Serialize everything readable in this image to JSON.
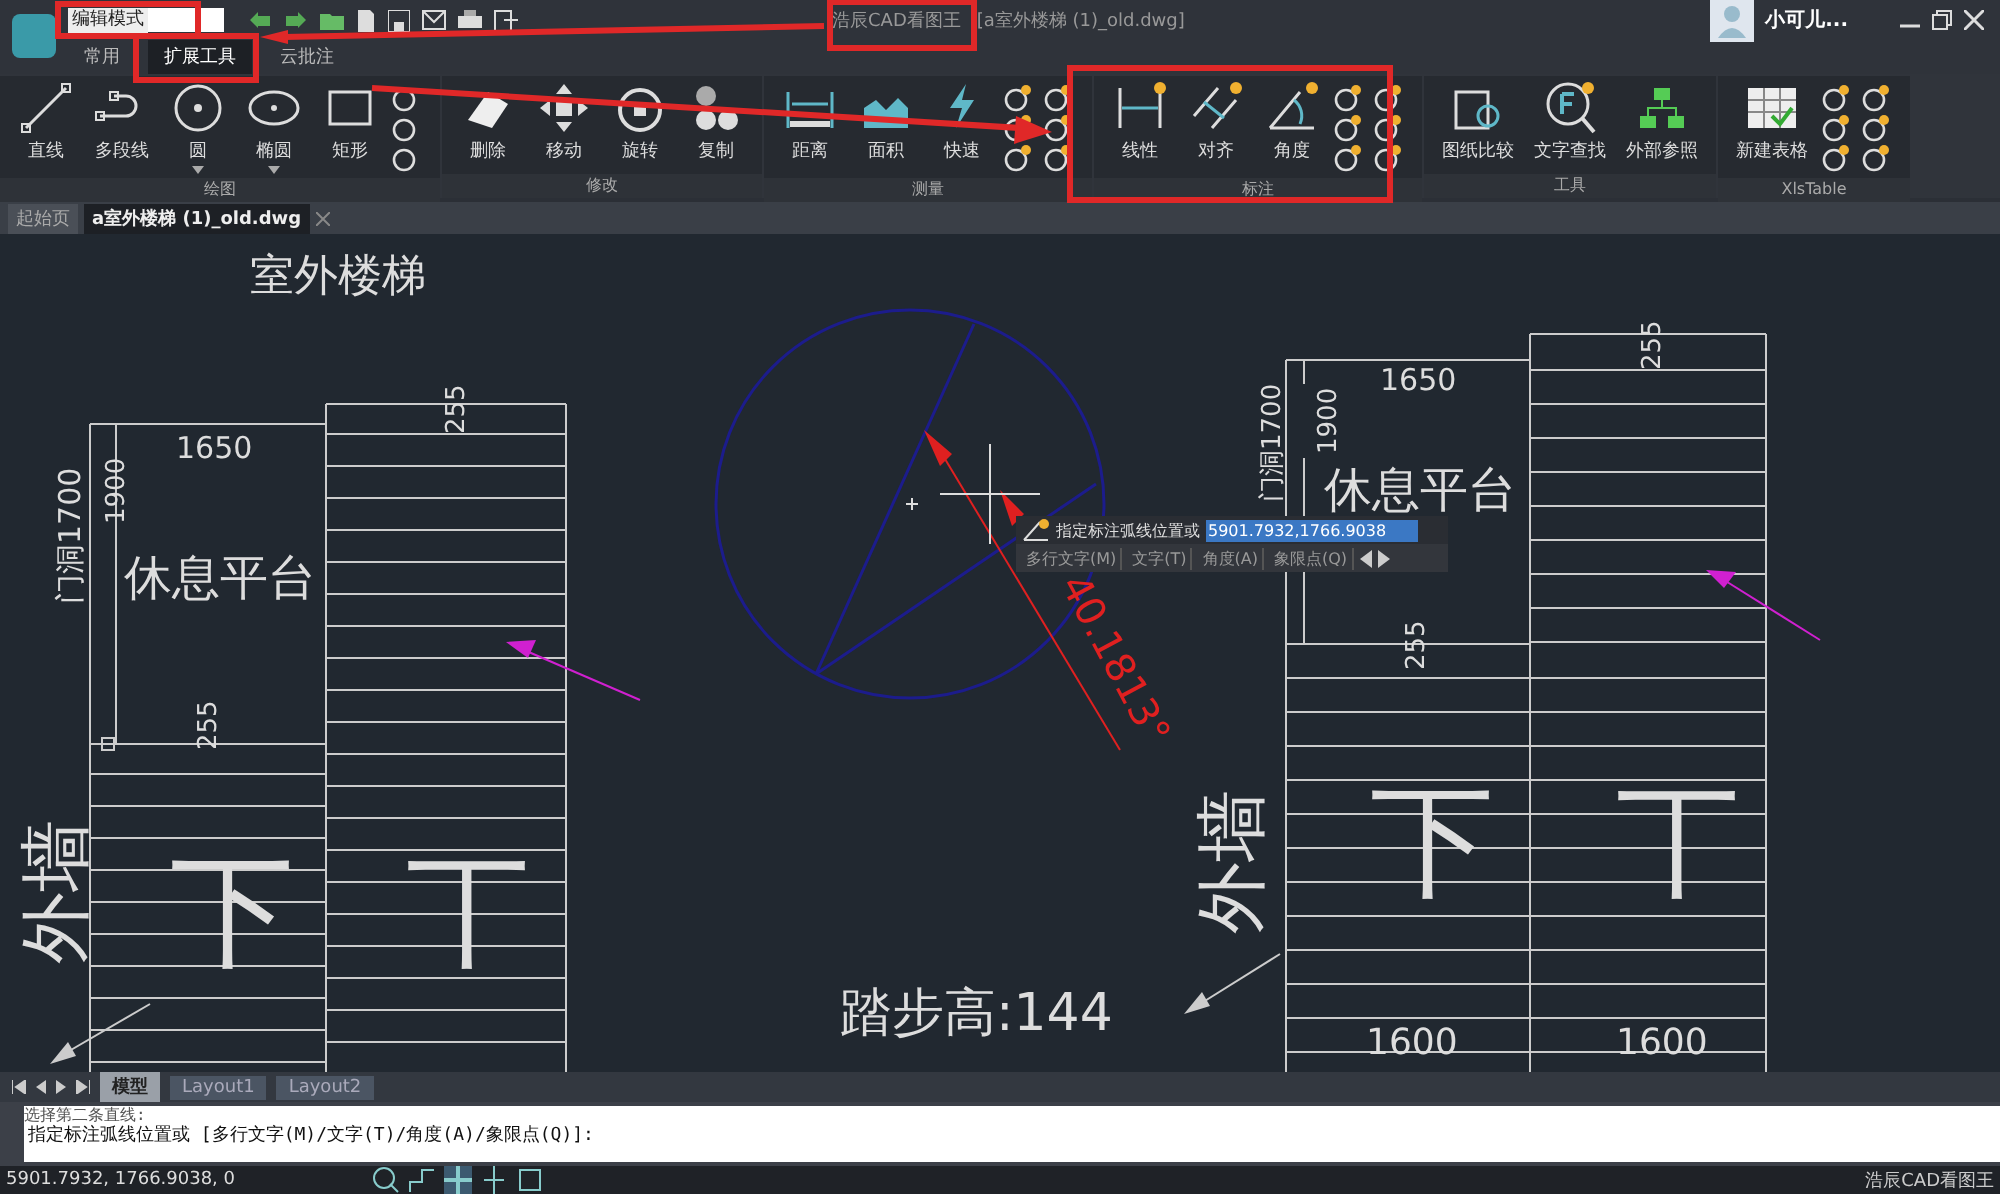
{
  "title_bar": {
    "mode": "编辑模式",
    "app_title": "浩辰CAD看图王",
    "file_title": "[a室外楼梯 (1)_old.dwg]",
    "user": "小可儿..."
  },
  "ribbon_tabs": [
    {
      "label": "常用",
      "selected": false
    },
    {
      "label": "扩展工具",
      "selected": true
    },
    {
      "label": "云批注",
      "selected": false
    }
  ],
  "ribbon_groups": [
    {
      "label": "绘图",
      "tools": [
        {
          "label": "直线",
          "dropdown": false
        },
        {
          "label": "多段线",
          "dropdown": false
        },
        {
          "label": "圆",
          "dropdown": true
        },
        {
          "label": "椭圆",
          "dropdown": true
        },
        {
          "label": "矩形",
          "dropdown": false
        }
      ]
    },
    {
      "label": "修改",
      "tools": [
        {
          "label": "删除",
          "dropdown": false
        },
        {
          "label": "移动",
          "dropdown": false
        },
        {
          "label": "旋转",
          "dropdown": false
        },
        {
          "label": "复制",
          "dropdown": false
        }
      ]
    },
    {
      "label": "测量",
      "tools": [
        {
          "label": "距离",
          "dropdown": false
        },
        {
          "label": "面积",
          "dropdown": false
        },
        {
          "label": "快速",
          "dropdown": false
        }
      ]
    },
    {
      "label": "标注",
      "tools": [
        {
          "label": "线性",
          "dropdown": false
        },
        {
          "label": "对齐",
          "dropdown": false
        },
        {
          "label": "角度",
          "dropdown": false
        }
      ]
    },
    {
      "label": "工具",
      "tools": [
        {
          "label": "图纸比较",
          "dropdown": false
        },
        {
          "label": "文字查找",
          "dropdown": false
        },
        {
          "label": "外部参照",
          "dropdown": false
        }
      ]
    },
    {
      "label": "XlsTable",
      "tools": [
        {
          "label": "新建表格",
          "dropdown": false
        }
      ]
    }
  ],
  "doc_tabs": [
    {
      "label": "起始页",
      "selected": false
    },
    {
      "label": "a室外楼梯 (1)_old.dwg",
      "selected": true
    }
  ],
  "drawing": {
    "texts": [
      "室外楼梯",
      "1650",
      "255",
      "门洞1700",
      "1900",
      "休息平台",
      "255",
      "外墙",
      "下",
      "丅",
      "踏步高:144",
      "1650",
      "255",
      "门洞1700",
      "1900",
      "休息平台",
      "255",
      "外墙",
      "下",
      "丅",
      "1600",
      "1600"
    ],
    "angle_dimension": "40.1813°"
  },
  "prompt": {
    "text": "指定标注弧线位置或",
    "value": "5901.7932,1766.9038",
    "options": [
      "多行文字(M)",
      "文字(T)",
      "角度(A)",
      "象限点(Q)"
    ]
  },
  "layout_tabs": [
    {
      "label": "模型",
      "selected": true
    },
    {
      "label": "Layout1",
      "selected": false
    },
    {
      "label": "Layout2",
      "selected": false
    }
  ],
  "command_line": {
    "history": "选择第二条直线:",
    "current": "指定标注弧线位置或 [多行文字(M)/文字(T)/角度(A)/象限点(Q)]:"
  },
  "status_bar": {
    "coordinates": "5901.7932, 1766.9038, 0",
    "brand": "浩辰CAD看图王"
  }
}
